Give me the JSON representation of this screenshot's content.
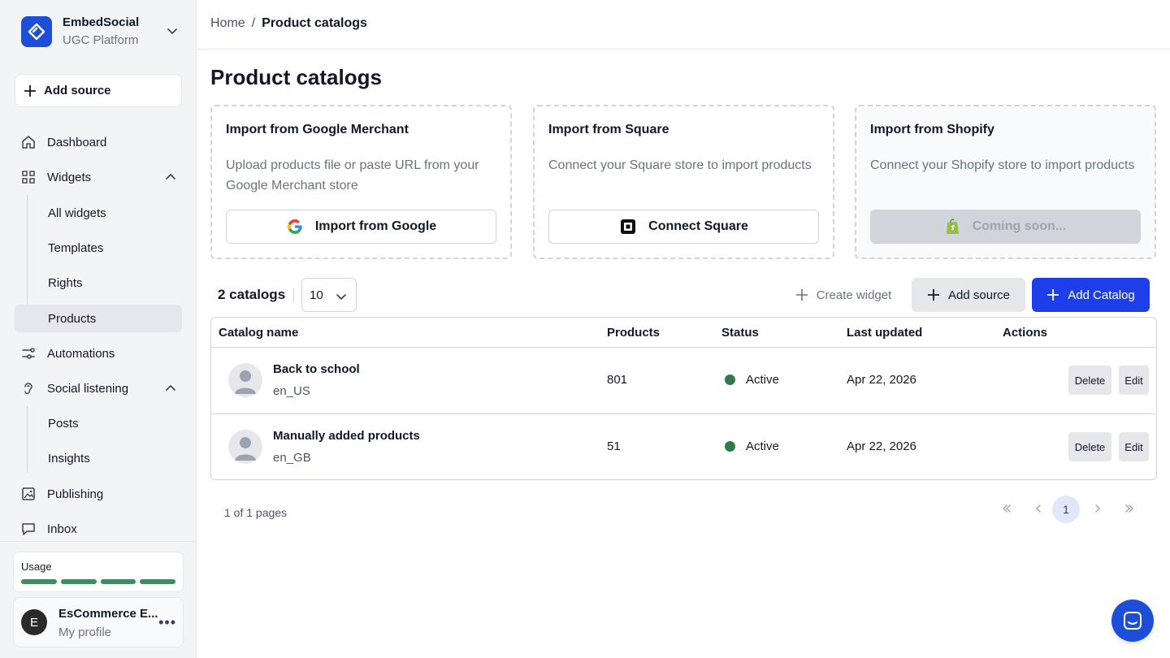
{
  "colors": {
    "accent": "#1d3ee8",
    "status_active": "#2f7a4c",
    "usage_bar": "#3b8f5c"
  },
  "brand": {
    "name": "EmbedSocial",
    "subtitle": "UGC Platform"
  },
  "sidebar": {
    "add_source": "Add source",
    "items": {
      "dashboard": "Dashboard",
      "widgets": "Widgets",
      "all_widgets": "All widgets",
      "templates": "Templates",
      "rights": "Rights",
      "products": "Products",
      "automations": "Automations",
      "social_listening": "Social listening",
      "posts": "Posts",
      "insights": "Insights",
      "publishing": "Publishing",
      "inbox": "Inbox"
    },
    "usage_label": "Usage",
    "profile": {
      "initial": "E",
      "name": "EsCommerce E...",
      "subtitle": "My profile"
    }
  },
  "breadcrumb": {
    "home": "Home",
    "separator": "/",
    "current": "Product catalogs"
  },
  "page_title": "Product catalogs",
  "import_cards": [
    {
      "title": "Import from Google Merchant",
      "description": "Upload products file or paste URL from your Google Merchant store",
      "button": "Import from Google"
    },
    {
      "title": "Import from Square",
      "description": "Connect your Square store to import products",
      "button": "Connect Square"
    },
    {
      "title": "Import from Shopify",
      "description": "Connect your Shopify store to import products",
      "button": "Coming soon..."
    }
  ],
  "toolbar": {
    "count": "2 catalogs",
    "page_size": "10",
    "create_widget": "Create widget",
    "add_source": "Add source",
    "add_catalog": "Add Catalog"
  },
  "table": {
    "headers": {
      "name": "Catalog name",
      "products": "Products",
      "status": "Status",
      "updated": "Last updated",
      "actions": "Actions"
    },
    "rows": [
      {
        "name": "Back to school",
        "locale": "en_US",
        "products": "801",
        "status": "Active",
        "updated": "Apr 22, 2026",
        "delete": "Delete",
        "edit": "Edit"
      },
      {
        "name": "Manually added products",
        "locale": "en_GB",
        "products": "51",
        "status": "Active",
        "updated": "Apr 22, 2026",
        "delete": "Delete",
        "edit": "Edit"
      }
    ]
  },
  "pagination": {
    "summary": "1 of 1 pages",
    "current": "1"
  }
}
